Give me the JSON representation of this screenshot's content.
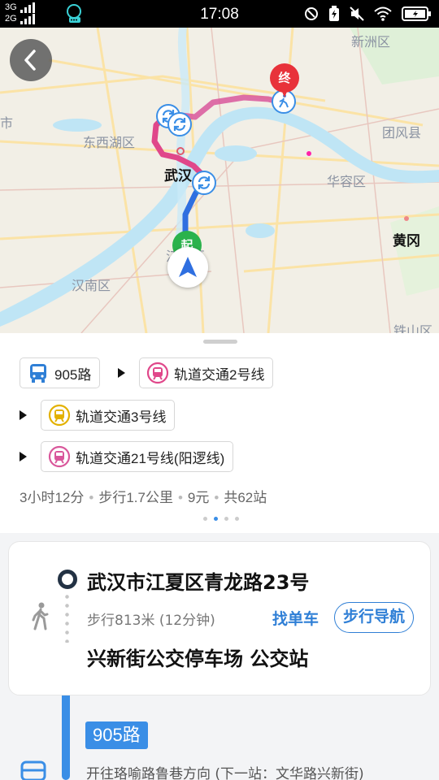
{
  "status_bar": {
    "net_top": "3G",
    "net_bottom": "2G",
    "time": "17:08"
  },
  "map": {
    "labels": {
      "xinzhou": "新洲区",
      "shi": "市",
      "dongxihu": "东西湖区",
      "wuhan": "武汉",
      "tuanfeng": "团风县",
      "huarong": "华容区",
      "huanggang": "黄冈",
      "jiangxia": "江夏区",
      "hannan": "汉南区",
      "tieshan": "铁山区"
    },
    "start_marker": "起",
    "end_marker": "终",
    "colors": {
      "route_blue": "#2f6fe0",
      "route_pink": "#e0478a",
      "start": "#2bb24c",
      "end": "#e8323a",
      "water": "#bfe5f5"
    }
  },
  "route_summary": {
    "segments": [
      {
        "label": "905路",
        "icon": "bus-icon",
        "color": "#2f7fd6"
      },
      {
        "label": "轨道交通2号线",
        "icon": "metro-icon",
        "color": "#e0478a"
      },
      {
        "label": "轨道交通3号线",
        "icon": "metro-icon",
        "color": "#e3b100"
      },
      {
        "label": "轨道交通21号线(阳逻线)",
        "icon": "metro-icon",
        "color": "#d9579b"
      }
    ],
    "duration": "3小时12分",
    "walk": "步行1.7公里",
    "price": "9元",
    "stops": "共62站",
    "separator": "•",
    "page_count": 4,
    "page_active": 1
  },
  "detail": {
    "start_address": "武汉市江夏区青龙路23号",
    "walk_info": "步行813米 (12分钟)",
    "find_bike": "找单车",
    "walk_nav": "步行导航",
    "board_stop": "兴新街公交停车场 公交站",
    "bus_line": "905路",
    "bus_direction": "开往珞喻路鲁巷方向 (下一站：文华路兴新街)"
  }
}
